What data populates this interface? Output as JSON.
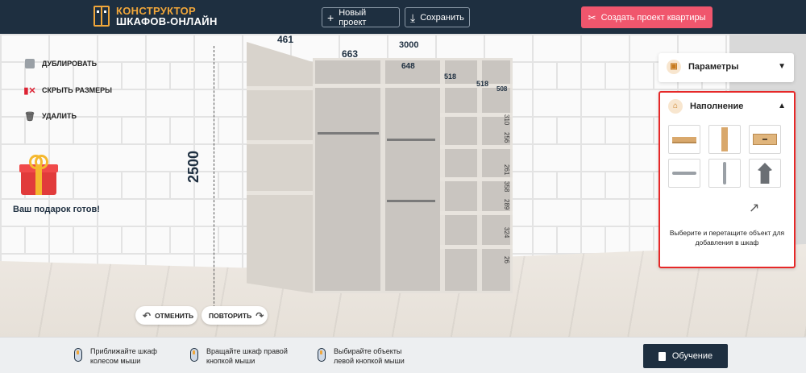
{
  "header": {
    "logo_line1": "КОНСТРУКТОР",
    "logo_line2": "ШКАФОВ-ОНЛАЙН",
    "new_project": "Новый проект",
    "save": "Сохранить",
    "create_apartment": "Создать проект квартиры"
  },
  "toolbar": {
    "duplicate": "ДУБЛИРОВАТЬ",
    "hide_sizes": "СКРЫТЬ РАЗМЕРЫ",
    "delete": "УДАЛИТЬ"
  },
  "gift": {
    "text": "Ваш подарок готов!"
  },
  "dimensions": {
    "height": "2500",
    "width_total": "3000",
    "depth": "461",
    "sec1": "663",
    "sec2": "648",
    "sec3": "518",
    "sec4": "518",
    "sec5": "508",
    "right_small": [
      "310",
      "256",
      "261",
      "358",
      "289",
      "324",
      "26"
    ]
  },
  "actions": {
    "undo": "ОТМЕНИТЬ",
    "redo": "ПОВТОРИТЬ"
  },
  "panels": {
    "params_title": "Параметры",
    "fill_title": "Наполнение",
    "fill_hint": "Выберите и перетащите объект для добавления в шкаф",
    "items": [
      "shelf",
      "vertical-panel",
      "drawer",
      "horizontal-rod",
      "vertical-rod",
      "hanger"
    ]
  },
  "footer": {
    "tip1_l1": "Приближайте шкаф",
    "tip1_l2": "колесом мыши",
    "tip2_l1": "Вращайте шкаф правой",
    "tip2_l2": "кнопкой мыши",
    "tip3_l1": "Выбирайте объекты",
    "tip3_l2": "левой кнопкой мыши",
    "learn": "Обучение"
  },
  "colors": {
    "header_bg": "#1e2f40",
    "accent_orange": "#f0a63a",
    "accent_pink": "#f0566d",
    "highlight_red": "#e62828"
  }
}
